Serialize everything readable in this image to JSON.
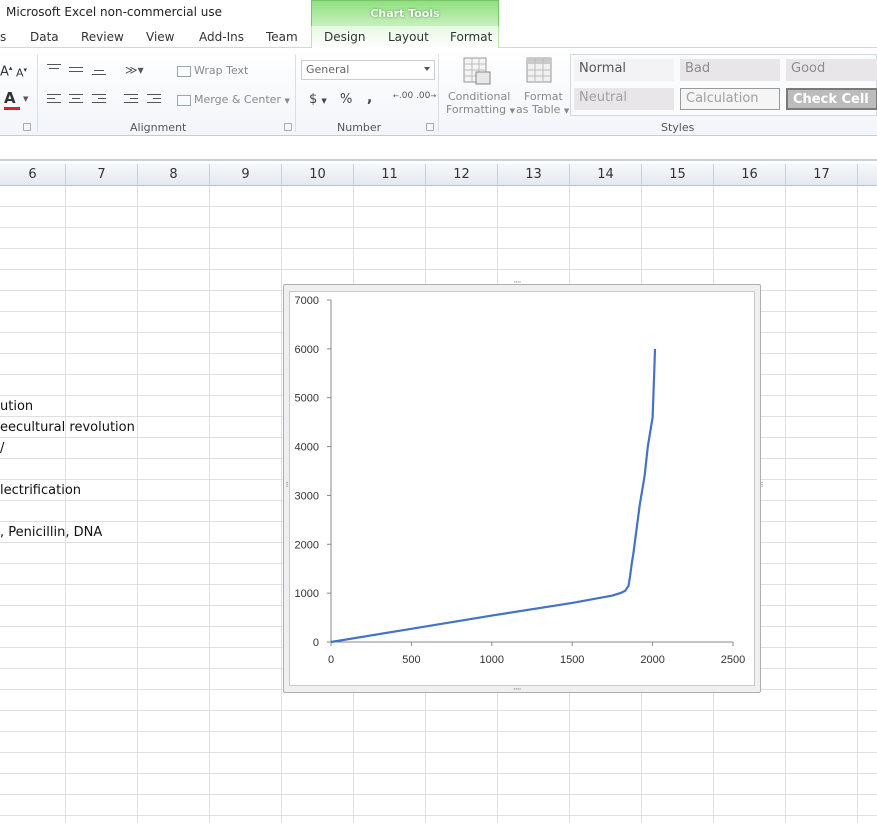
{
  "window": {
    "title": "Microsoft Excel non-commercial use"
  },
  "contextual": {
    "label": "Chart Tools"
  },
  "tabs": [
    "s",
    "Data",
    "Review",
    "View",
    "Add-Ins",
    "Team",
    "Design",
    "Layout",
    "Format"
  ],
  "ribbon": {
    "wrap_text": "Wrap Text",
    "merge_center": "Merge & Center",
    "number_format": "General",
    "currency": "$",
    "percent": "%",
    "comma": ",",
    "inc_decimal": ".00",
    "dec_decimal": ".00",
    "conditional_formatting": [
      "Conditional",
      "Formatting"
    ],
    "format_as_table": [
      "Format",
      "as Table"
    ],
    "groups": {
      "alignment": "Alignment",
      "number": "Number",
      "styles": "Styles"
    },
    "styles": [
      {
        "label": "Normal",
        "bg": "#f3f3f5",
        "color": "#555555"
      },
      {
        "label": "Bad",
        "bg": "#e9e6ea",
        "color": "#8c8c8c"
      },
      {
        "label": "Good",
        "bg": "#e9e6ea",
        "color": "#8c8c8c"
      },
      {
        "label": "Neutral",
        "bg": "#e9e6ea",
        "color": "#a0a0a0"
      },
      {
        "label": "Calculation",
        "bg": "#f5f5f5",
        "color": "#a0a0a0"
      },
      {
        "label": "Check Cell",
        "bg": "#bcbcbc",
        "color": "#ffffff"
      }
    ]
  },
  "columns": [
    "6",
    "7",
    "8",
    "9",
    "10",
    "11",
    "12",
    "13",
    "14",
    "15",
    "16",
    "17"
  ],
  "cells": [
    "ution",
    "eecultural revolution",
    "/",
    "lectrification",
    ", Penicillin, DNA"
  ],
  "chart_data": {
    "type": "line",
    "title": "",
    "xlabel": "",
    "ylabel": "",
    "xlim": [
      0,
      2500
    ],
    "ylim": [
      0,
      7000
    ],
    "x_ticks": [
      "0",
      "500",
      "1000",
      "1500",
      "2000",
      "2500"
    ],
    "y_ticks": [
      "0",
      "1000",
      "2000",
      "3000",
      "4000",
      "5000",
      "6000",
      "7000"
    ],
    "series": [
      {
        "color": "#4472c4",
        "x": [
          0,
          500,
          1000,
          1500,
          1750,
          1800,
          1830,
          1850,
          1860,
          1870,
          1880,
          1900,
          1920,
          1950,
          1970,
          1980,
          2000,
          2010,
          2015
        ],
        "y": [
          0,
          270,
          540,
          800,
          950,
          1000,
          1050,
          1150,
          1350,
          1600,
          1800,
          2300,
          2800,
          3400,
          4000,
          4200,
          4600,
          5500,
          6000
        ]
      }
    ],
    "grid": false,
    "legend": "none"
  }
}
